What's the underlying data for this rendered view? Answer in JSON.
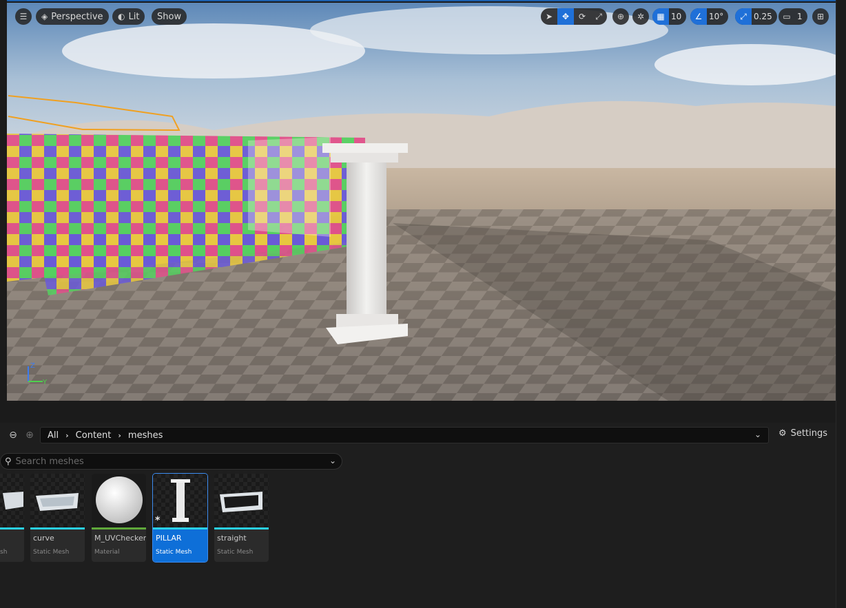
{
  "viewport": {
    "toolbar": {
      "perspective_label": "Perspective",
      "lit_label": "Lit",
      "show_label": "Show",
      "grid_snap_value": "10",
      "rotation_snap_value": "10°",
      "scale_snap_value": "0.25",
      "camera_speed_value": "1"
    },
    "axis": {
      "z": "Z",
      "y": "Y"
    },
    "colors": {
      "selection_outline": "#f0a020",
      "accent": "#1f70d8"
    }
  },
  "content_browser": {
    "breadcrumb": [
      "All",
      "Content",
      "meshes"
    ],
    "settings_label": "Settings",
    "search_placeholder": "Search meshes",
    "assets": [
      {
        "name": "",
        "type": "sh"
      },
      {
        "name": "curve",
        "type": "Static Mesh"
      },
      {
        "name": "M_UVChecker",
        "type": "Material"
      },
      {
        "name": "PILLAR",
        "type": "Static Mesh"
      },
      {
        "name": "straight",
        "type": "Static Mesh"
      }
    ]
  }
}
